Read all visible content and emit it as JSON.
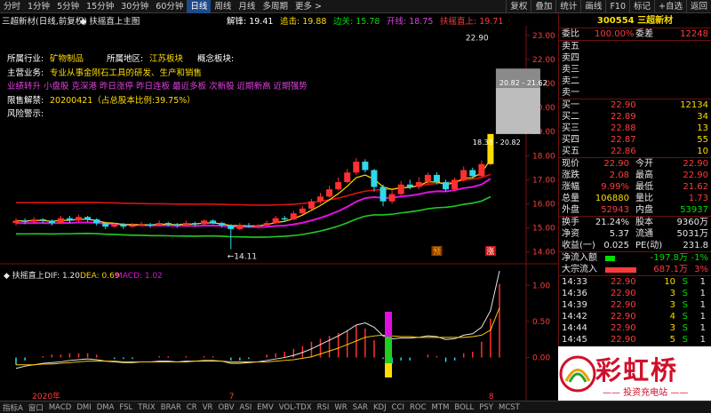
{
  "toolbar": {
    "periods": [
      "分时",
      "1分钟",
      "5分钟",
      "15分钟",
      "30分钟",
      "60分钟",
      "日线",
      "周线",
      "月线",
      "多周期",
      "更多 >"
    ],
    "active": "日线",
    "right": [
      "复权",
      "叠加",
      "统计",
      "画线",
      "F10",
      "标记",
      "+自选",
      "返回"
    ]
  },
  "header": {
    "title": "三超新材(日线,前复权)",
    "indicator": "◆ 扶摇直上主图",
    "items": [
      {
        "label": "解锋",
        "value": "19.41",
        "color": "#ffffff"
      },
      {
        "label": "追击",
        "value": "19.88",
        "color": "#ffdd00"
      },
      {
        "label": "边关",
        "value": "15.78",
        "color": "#00dd00"
      },
      {
        "label": "开线",
        "value": "18.75",
        "color": "#e040e0"
      },
      {
        "label": "扶摇直上",
        "value": "19.71",
        "color": "#ff3c3c"
      }
    ]
  },
  "info": {
    "industry_label": "所属行业:",
    "industry": "矿物制品",
    "region_label": "所属地区:",
    "region": "江苏板块",
    "concept_label": "概念板块:",
    "business_label": "主营业务:",
    "business": "专业从事金刚石工具的研发、生产和销售",
    "concepts": "业绩转升 小盘股 克深港 昨日涨停 昨日连板 最近多板 次新股 近期新高 近期强势",
    "unlock_label": "限售解禁:",
    "unlock": "20200421（占总股本比例:39.75%）",
    "risk_label": "风险警示:"
  },
  "chart_data": {
    "type": "candlestick",
    "price_axis": [
      23.0,
      22.0,
      21.0,
      20.0,
      19.0,
      18.0,
      17.0,
      16.0,
      15.0,
      14.0
    ],
    "ylim": [
      13.8,
      23.4
    ],
    "candles": [
      [
        15.2,
        15.3,
        15.4,
        15.1
      ],
      [
        15.3,
        15.25,
        15.4,
        15.15
      ],
      [
        15.25,
        15.35,
        15.45,
        15.2
      ],
      [
        15.35,
        15.3,
        15.4,
        15.2
      ],
      [
        15.3,
        15.2,
        15.35,
        15.1
      ],
      [
        15.2,
        15.4,
        15.5,
        15.15
      ],
      [
        15.4,
        15.3,
        15.5,
        15.2
      ],
      [
        15.3,
        15.45,
        15.55,
        15.25
      ],
      [
        15.45,
        15.35,
        15.5,
        15.25
      ],
      [
        15.35,
        15.2,
        15.4,
        15.1
      ],
      [
        15.2,
        15.05,
        15.25,
        14.95
      ],
      [
        15.05,
        15.15,
        15.2,
        15.0
      ],
      [
        15.15,
        15.05,
        15.2,
        14.95
      ],
      [
        15.05,
        15.1,
        15.2,
        15.0
      ],
      [
        15.1,
        15.15,
        15.25,
        15.05
      ],
      [
        15.15,
        15.1,
        15.2,
        15.0
      ],
      [
        15.1,
        15.2,
        15.3,
        15.05
      ],
      [
        15.2,
        15.15,
        15.25,
        15.05
      ],
      [
        15.15,
        15.1,
        15.2,
        15.0
      ],
      [
        15.1,
        15.2,
        15.3,
        15.05
      ],
      [
        15.2,
        15.15,
        15.25,
        15.05
      ],
      [
        15.15,
        15.3,
        15.35,
        15.1
      ],
      [
        15.3,
        15.2,
        15.35,
        15.15
      ],
      [
        15.2,
        15.1,
        15.25,
        15.0
      ],
      [
        15.1,
        14.95,
        15.15,
        14.11
      ],
      [
        14.95,
        15.1,
        15.2,
        14.9
      ],
      [
        15.1,
        15.05,
        15.2,
        15.0
      ],
      [
        15.05,
        15.1,
        15.15,
        15.0
      ],
      [
        15.1,
        15.2,
        15.3,
        15.05
      ],
      [
        15.2,
        15.4,
        15.5,
        15.15
      ],
      [
        15.4,
        15.35,
        15.5,
        15.25
      ],
      [
        15.35,
        15.6,
        15.7,
        15.3
      ],
      [
        15.6,
        15.8,
        15.9,
        15.55
      ],
      [
        15.8,
        16.1,
        16.2,
        15.75
      ],
      [
        16.1,
        16.3,
        16.45,
        16.0
      ],
      [
        16.3,
        16.6,
        16.75,
        16.25
      ],
      [
        16.6,
        16.9,
        17.1,
        16.55
      ],
      [
        16.9,
        17.3,
        17.45,
        16.85
      ],
      [
        17.3,
        17.75,
        17.9,
        17.2
      ],
      [
        17.75,
        17.4,
        17.85,
        17.3
      ],
      [
        17.4,
        16.7,
        17.45,
        16.5
      ],
      [
        16.7,
        16.1,
        16.8,
        15.9
      ],
      [
        16.1,
        16.4,
        16.55,
        16.0
      ],
      [
        16.4,
        16.8,
        16.95,
        16.35
      ],
      [
        16.8,
        16.7,
        17.0,
        16.6
      ],
      [
        16.7,
        16.9,
        17.1,
        16.6
      ],
      [
        16.9,
        17.2,
        17.3,
        16.8
      ],
      [
        17.2,
        16.9,
        17.3,
        16.8
      ],
      [
        16.9,
        16.6,
        17.0,
        16.5
      ],
      [
        16.6,
        17.0,
        17.1,
        16.55
      ],
      [
        17.0,
        17.4,
        17.55,
        16.95
      ],
      [
        17.4,
        17.15,
        17.5,
        17.05
      ],
      [
        17.15,
        17.65,
        17.8,
        17.1
      ],
      [
        17.65,
        18.9,
        18.9,
        17.6
      ]
    ],
    "annotations": [
      {
        "text": "22.90",
        "price": 22.9,
        "index": 53
      },
      {
        "text": "14.11",
        "price": 14.11,
        "index": 24
      },
      {
        "text": "20.82 - 21.62",
        "price": 20.0,
        "index": 53
      },
      {
        "text": "18.38 - 20.82",
        "price": 18.5,
        "index": 53
      }
    ],
    "markers": [
      {
        "text": "预",
        "index": 47,
        "color": "#ffaa00",
        "bg": "#8a3a00"
      },
      {
        "text": "涨",
        "index": 53,
        "color": "#ffffff",
        "bg": "#c81010"
      }
    ],
    "macd": {
      "name": "扶摇直上",
      "dif": "1.20",
      "dea": "0.69",
      "macd": "1.02"
    },
    "macd_axis": [
      1.0,
      0.5,
      0.0
    ],
    "macd_ylim": [
      -0.35,
      1.25
    ],
    "macd_dif": [
      -0.15,
      -0.12,
      -0.1,
      -0.08,
      -0.07,
      -0.06,
      -0.04,
      -0.03,
      -0.02,
      -0.03,
      -0.05,
      -0.06,
      -0.07,
      -0.07,
      -0.06,
      -0.06,
      -0.05,
      -0.05,
      -0.06,
      -0.05,
      -0.05,
      -0.04,
      -0.04,
      -0.05,
      -0.08,
      -0.08,
      -0.07,
      -0.06,
      -0.04,
      -0.02,
      0.0,
      0.03,
      0.07,
      0.12,
      0.18,
      0.24,
      0.3,
      0.37,
      0.45,
      0.48,
      0.42,
      0.3,
      0.26,
      0.27,
      0.27,
      0.28,
      0.3,
      0.29,
      0.25,
      0.26,
      0.31,
      0.33,
      0.42,
      0.65,
      1.2
    ],
    "macd_dea": [
      -0.1,
      -0.1,
      -0.1,
      -0.09,
      -0.09,
      -0.08,
      -0.07,
      -0.06,
      -0.05,
      -0.05,
      -0.05,
      -0.05,
      -0.06,
      -0.06,
      -0.06,
      -0.06,
      -0.06,
      -0.06,
      -0.06,
      -0.06,
      -0.05,
      -0.05,
      -0.05,
      -0.05,
      -0.06,
      -0.06,
      -0.06,
      -0.06,
      -0.06,
      -0.05,
      -0.04,
      -0.03,
      -0.01,
      0.01,
      0.05,
      0.09,
      0.13,
      0.18,
      0.23,
      0.28,
      0.3,
      0.31,
      0.3,
      0.29,
      0.29,
      0.28,
      0.28,
      0.28,
      0.28,
      0.28,
      0.28,
      0.29,
      0.31,
      0.38,
      0.69
    ],
    "x_labels": [
      {
        "text": "2020年",
        "index": 2
      },
      {
        "text": "7",
        "index": 24
      },
      {
        "text": "8",
        "index": 53
      }
    ]
  },
  "panel": {
    "code": "300554",
    "name": "三超新材",
    "weibi_label": "委比",
    "weibi": "100.00%",
    "weicha_label": "委差",
    "weicha": "12248",
    "asks": [
      {
        "label": "卖五",
        "price": "",
        "vol": ""
      },
      {
        "label": "卖四",
        "price": "",
        "vol": ""
      },
      {
        "label": "卖三",
        "price": "",
        "vol": ""
      },
      {
        "label": "卖二",
        "price": "",
        "vol": ""
      },
      {
        "label": "卖一",
        "price": "",
        "vol": ""
      }
    ],
    "bids": [
      {
        "label": "买一",
        "price": "22.90",
        "vol": "12134"
      },
      {
        "label": "买二",
        "price": "22.89",
        "vol": "34"
      },
      {
        "label": "买三",
        "price": "22.88",
        "vol": "13"
      },
      {
        "label": "买四",
        "price": "22.87",
        "vol": "55"
      },
      {
        "label": "买五",
        "price": "22.86",
        "vol": "10"
      }
    ],
    "stats": [
      {
        "l1": "现价",
        "v1": "22.90",
        "c1": "red",
        "l2": "今开",
        "v2": "22.90",
        "c2": "red"
      },
      {
        "l1": "涨跌",
        "v1": "2.08",
        "c1": "red",
        "l2": "最高",
        "v2": "22.90",
        "c2": "red"
      },
      {
        "l1": "涨幅",
        "v1": "9.99%",
        "c1": "red",
        "l2": "最低",
        "v2": "21.62",
        "c2": "red"
      },
      {
        "l1": "总量",
        "v1": "106880",
        "c1": "yellow",
        "l2": "量比",
        "v2": "1.73",
        "c2": "red"
      },
      {
        "l1": "外盘",
        "v1": "52943",
        "c1": "red",
        "l2": "内盘",
        "v2": "53937",
        "c2": "green"
      }
    ],
    "stats2": [
      {
        "l1": "换手",
        "v1": "21.24%",
        "l2": "股本",
        "v2": "9360万"
      },
      {
        "l1": "净资",
        "v1": "5.37",
        "l2": "流通",
        "v2": "5031万"
      },
      {
        "l1": "收益(一)",
        "v1": "0.025",
        "l2": "PE(动)",
        "v2": "231.8"
      }
    ],
    "flows": [
      {
        "label": "净流入额",
        "value": "-197.8万",
        "pct": "-1%",
        "bar": "#00dd00",
        "frac": 0.2
      },
      {
        "label": "大宗流入",
        "value": "687.1万",
        "pct": "3%",
        "bar": "#ff3c3c",
        "frac": 0.65
      }
    ],
    "ticks": [
      {
        "t": "14:33",
        "p": "22.90",
        "v": "10",
        "s": "S",
        "n": "1"
      },
      {
        "t": "14:36",
        "p": "22.90",
        "v": "3",
        "s": "S",
        "n": "1"
      },
      {
        "t": "14:39",
        "p": "22.90",
        "v": "3",
        "s": "S",
        "n": "1"
      },
      {
        "t": "14:42",
        "p": "22.90",
        "v": "4",
        "s": "S",
        "n": "1"
      },
      {
        "t": "14:44",
        "p": "22.90",
        "v": "3",
        "s": "S",
        "n": "1"
      },
      {
        "t": "14:45",
        "p": "22.90",
        "v": "5",
        "s": "S",
        "n": "1"
      },
      {
        "t": "14:46",
        "p": "22.90",
        "v": "1",
        "s": "S",
        "n": "1"
      },
      {
        "t": "14:49",
        "p": "22.90",
        "v": "",
        "s": "",
        "n": ""
      },
      {
        "t": "14:51",
        "p": "22.90",
        "v": "",
        "s": "",
        "n": ""
      },
      {
        "t": "14:53",
        "p": "22.90",
        "v": "",
        "s": "",
        "n": ""
      }
    ]
  },
  "watermark": {
    "brand": "彩虹桥",
    "sub": "—— 投资充电站 ——"
  },
  "bottom_tabs": [
    "指标A",
    "窗口",
    "MACD",
    "DMI",
    "DMA",
    "FSL",
    "TRIX",
    "BRAR",
    "CR",
    "VR",
    "OBV",
    "ASI",
    "EMV",
    "VOL-TDX",
    "RSI",
    "WR",
    "SAR",
    "KDJ",
    "CCI",
    "ROC",
    "MTM",
    "BOLL",
    "PSY",
    "MCST"
  ]
}
